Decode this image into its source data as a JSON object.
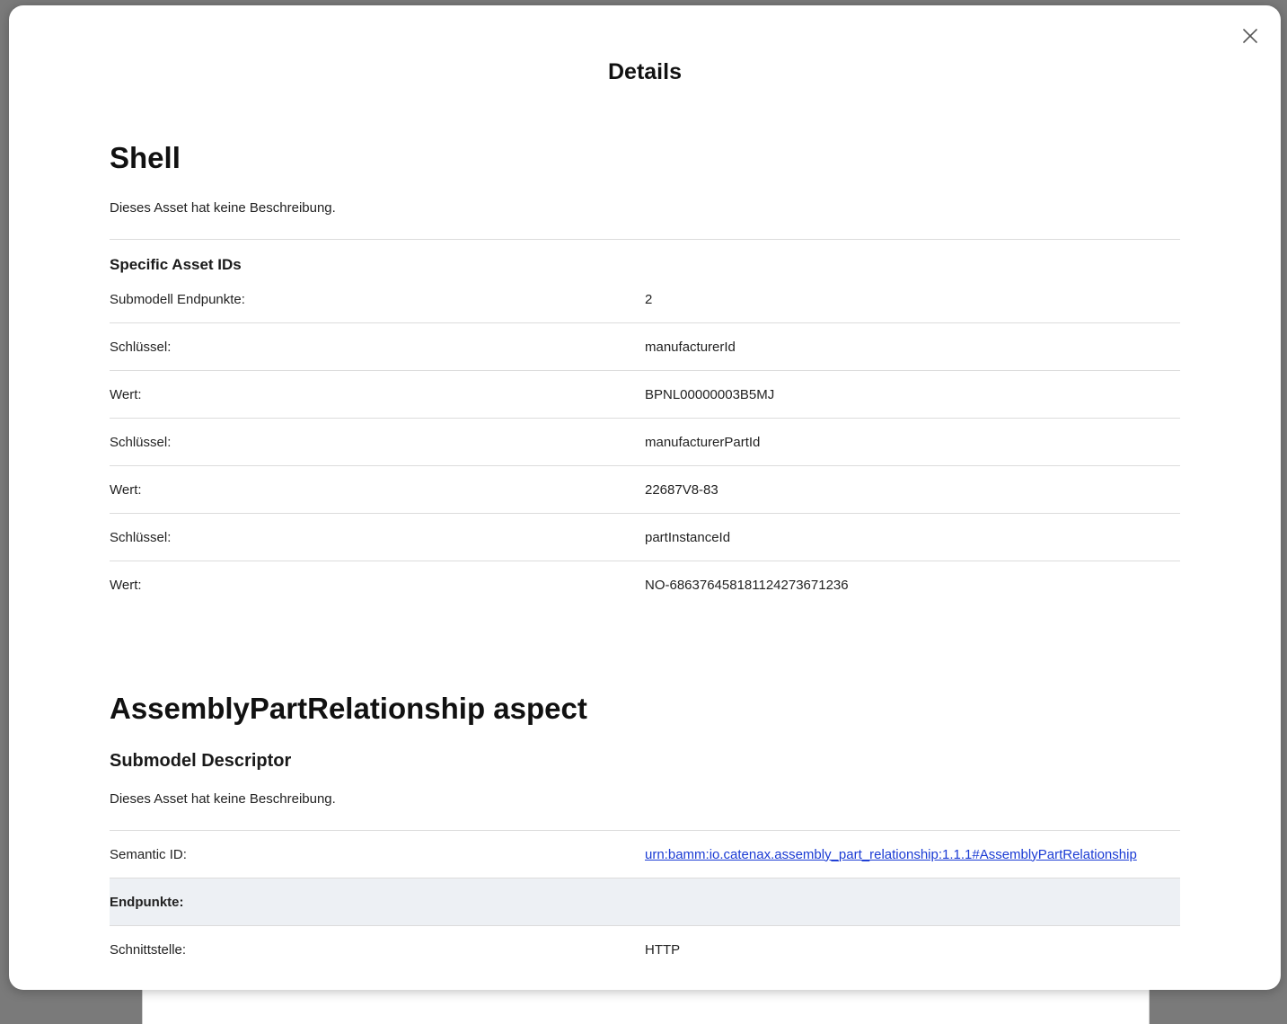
{
  "modal": {
    "title": "Details"
  },
  "shell": {
    "title": "Shell",
    "description": "Dieses Asset hat keine Beschreibung.",
    "specific_asset_ids_title": "Specific Asset IDs",
    "rows": [
      {
        "key": "Submodell Endpunkte:",
        "value": "2"
      },
      {
        "key": "Schlüssel:",
        "value": "manufacturerId"
      },
      {
        "key": "Wert:",
        "value": "BPNL00000003B5MJ"
      },
      {
        "key": "Schlüssel:",
        "value": "manufacturerPartId"
      },
      {
        "key": "Wert:",
        "value": "22687V8-83"
      },
      {
        "key": "Schlüssel:",
        "value": "partInstanceId"
      },
      {
        "key": "Wert:",
        "value": "NO-686376458181124273671236"
      }
    ]
  },
  "aspect": {
    "title": "AssemblyPartRelationship aspect",
    "submodel_descriptor_title": "Submodel Descriptor",
    "description": "Dieses Asset hat keine Beschreibung.",
    "semantic_id_label": "Semantic ID:",
    "semantic_id_value": "urn:bamm:io.catenax.assembly_part_relationship:1.1.1#AssemblyPartRelationship",
    "endpoints_label": "Endpunkte:",
    "interface_label": "Schnittstelle:",
    "interface_value": "HTTP"
  },
  "icons": {
    "close": "close-icon"
  },
  "colors": {
    "link": "#1a3bd4",
    "group_row_bg": "#edf0f4",
    "divider": "#dcdcdc"
  }
}
